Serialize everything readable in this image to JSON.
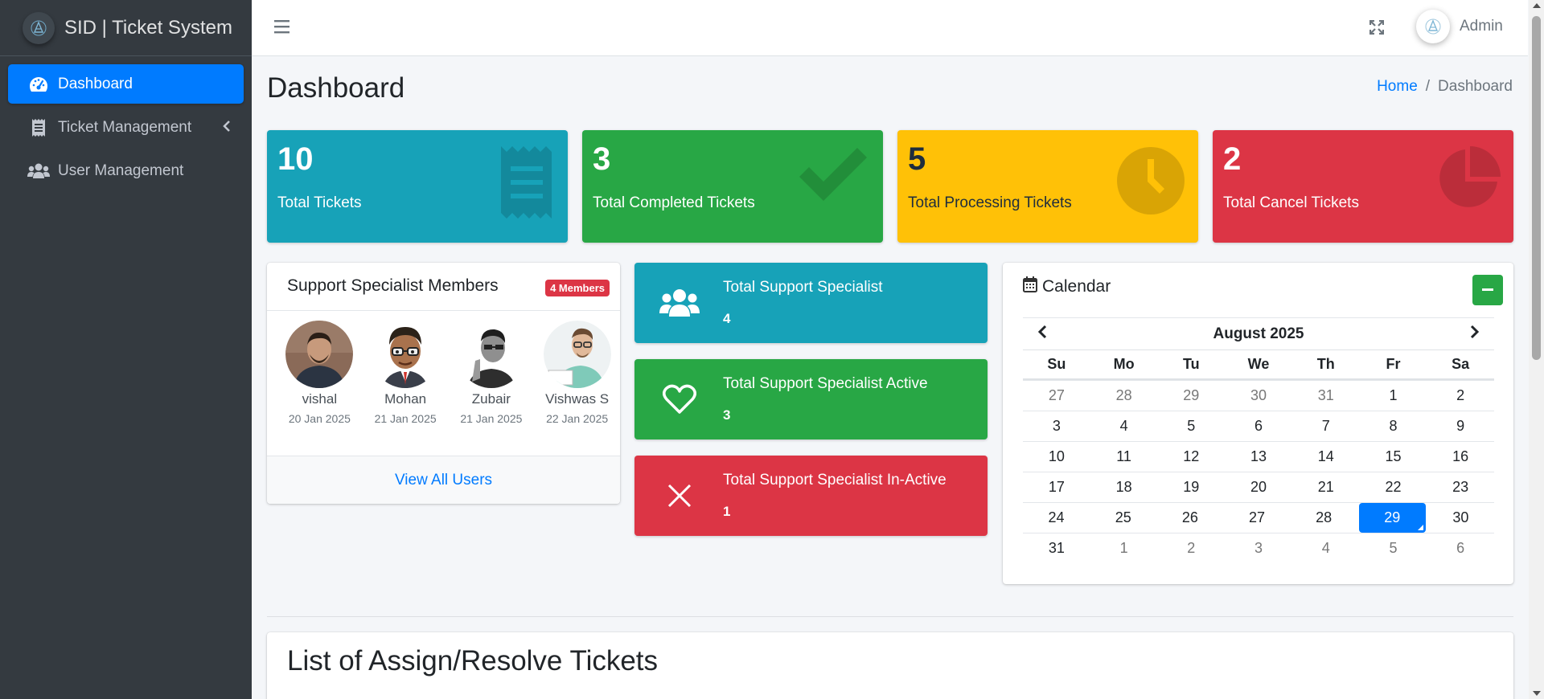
{
  "brand": {
    "title": "SID | Ticket System"
  },
  "sidebar": {
    "items": [
      {
        "label": "Dashboard",
        "icon": "tachometer-icon",
        "active": true
      },
      {
        "label": "Ticket Management",
        "icon": "receipt-icon"
      },
      {
        "label": "User Management",
        "icon": "users-icon"
      }
    ]
  },
  "topbar": {
    "user": "Admin"
  },
  "page": {
    "title": "Dashboard",
    "breadcrumb": [
      "Home",
      "/",
      "Dashboard"
    ]
  },
  "stats": [
    {
      "value": "10",
      "label": "Total Tickets",
      "icon": "receipt-icon",
      "color": "#17a2b8"
    },
    {
      "value": "3",
      "label": "Total Completed Tickets",
      "icon": "check-icon",
      "color": "#28a745"
    },
    {
      "value": "5",
      "label": "Total Processing Tickets",
      "icon": "clock-icon",
      "color": "#ffc107"
    },
    {
      "value": "2",
      "label": "Total Cancel Tickets",
      "icon": "pie-chart-icon",
      "color": "#dc3545"
    }
  ],
  "members": {
    "title": "Support Specialist Members",
    "badge": "4 Members",
    "list": [
      {
        "name": "vishal",
        "date": "20 Jan 2025"
      },
      {
        "name": "Mohan",
        "date": "21 Jan 2025"
      },
      {
        "name": "Zubair",
        "date": "21 Jan 2025"
      },
      {
        "name": "Vishwas S",
        "date": "22 Jan 2025"
      }
    ],
    "footer": "View All Users"
  },
  "info_boxes": [
    {
      "title": "Total Support Specialist",
      "value": "4",
      "icon": "users-icon"
    },
    {
      "title": "Total Support Specialist Active",
      "value": "3",
      "icon": "heart-icon"
    },
    {
      "title": "Total Support Specialist In-Active",
      "value": "1",
      "icon": "close-icon"
    }
  ],
  "calendar": {
    "title": "Calendar",
    "month": "August 2025",
    "weekdays": [
      "Su",
      "Mo",
      "Tu",
      "We",
      "Th",
      "Fr",
      "Sa"
    ],
    "weeks": [
      [
        "27",
        "28",
        "29",
        "30",
        "31",
        "1",
        "2"
      ],
      [
        "3",
        "4",
        "5",
        "6",
        "7",
        "8",
        "9"
      ],
      [
        "10",
        "11",
        "12",
        "13",
        "14",
        "15",
        "16"
      ],
      [
        "17",
        "18",
        "19",
        "20",
        "21",
        "22",
        "23"
      ],
      [
        "24",
        "25",
        "26",
        "27",
        "28",
        "29",
        "30"
      ],
      [
        "31",
        "1",
        "2",
        "3",
        "4",
        "5",
        "6"
      ]
    ],
    "selected": "29"
  },
  "list": {
    "title": "List of Assign/Resolve Tickets"
  }
}
